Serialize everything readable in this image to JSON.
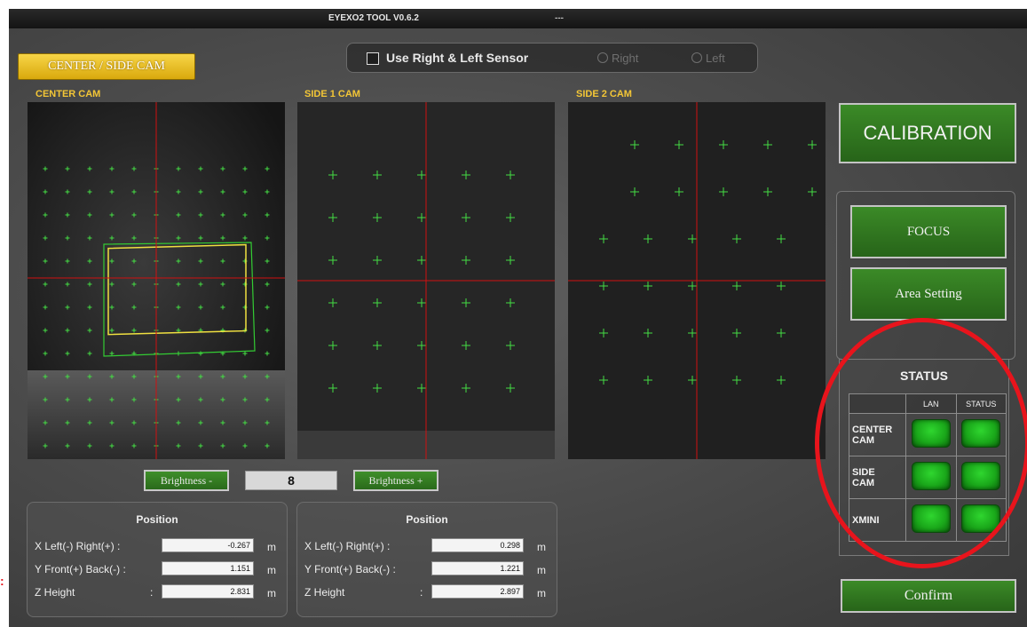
{
  "window": {
    "title": "EYEXO2 TOOL V0.6.2",
    "status": "---"
  },
  "mode_tab": {
    "label": "CENTER / SIDE CAM"
  },
  "sensor_bar": {
    "checkbox_label": "Use Right & Left Sensor",
    "radio_right": "Right",
    "radio_left": "Left"
  },
  "cameras": {
    "center": {
      "label": "CENTER CAM"
    },
    "side1": {
      "label": "SIDE 1 CAM"
    },
    "side2": {
      "label": "SIDE 2 CAM"
    }
  },
  "brightness": {
    "minus_label": "Brightness -",
    "value": "8",
    "plus_label": "Brightness +"
  },
  "position_left": {
    "title": "Position",
    "rows": [
      {
        "label": "X  Left(-) Right(+)   :",
        "value": "-0.267",
        "unit": "m"
      },
      {
        "label": "Y  Front(+) Back(-) :",
        "value": "1.151",
        "unit": "m"
      },
      {
        "label": "Z  Height",
        "colon": ":",
        "value": "2.831",
        "unit": "m"
      }
    ]
  },
  "position_right": {
    "title": "Position",
    "rows": [
      {
        "label": "X  Left(-) Right(+)   :",
        "value": "0.298",
        "unit": "m"
      },
      {
        "label": "Y  Front(+) Back(-) :",
        "value": "1.221",
        "unit": "m"
      },
      {
        "label": "Z  Height",
        "colon": ":",
        "value": "2.897",
        "unit": "m"
      }
    ]
  },
  "actions": {
    "calibration": "CALIBRATION",
    "focus": "FOCUS",
    "area_setting": "Area Setting",
    "confirm": "Confirm"
  },
  "status": {
    "title": "STATUS",
    "col_lan": "LAN",
    "col_status": "STATUS",
    "rows": [
      {
        "line1": "CENTER",
        "line2": "CAM"
      },
      {
        "line1": "SIDE",
        "line2": "CAM"
      },
      {
        "line1": "XMINI",
        "line2": ""
      }
    ]
  },
  "colors": {
    "accent_yellow": "#f3c636",
    "button_green": "#2f7a22",
    "led_green": "#22c322",
    "annotation_red": "#e8141c",
    "crosshair_red": "#d01010",
    "marker_green": "#44dd44"
  }
}
